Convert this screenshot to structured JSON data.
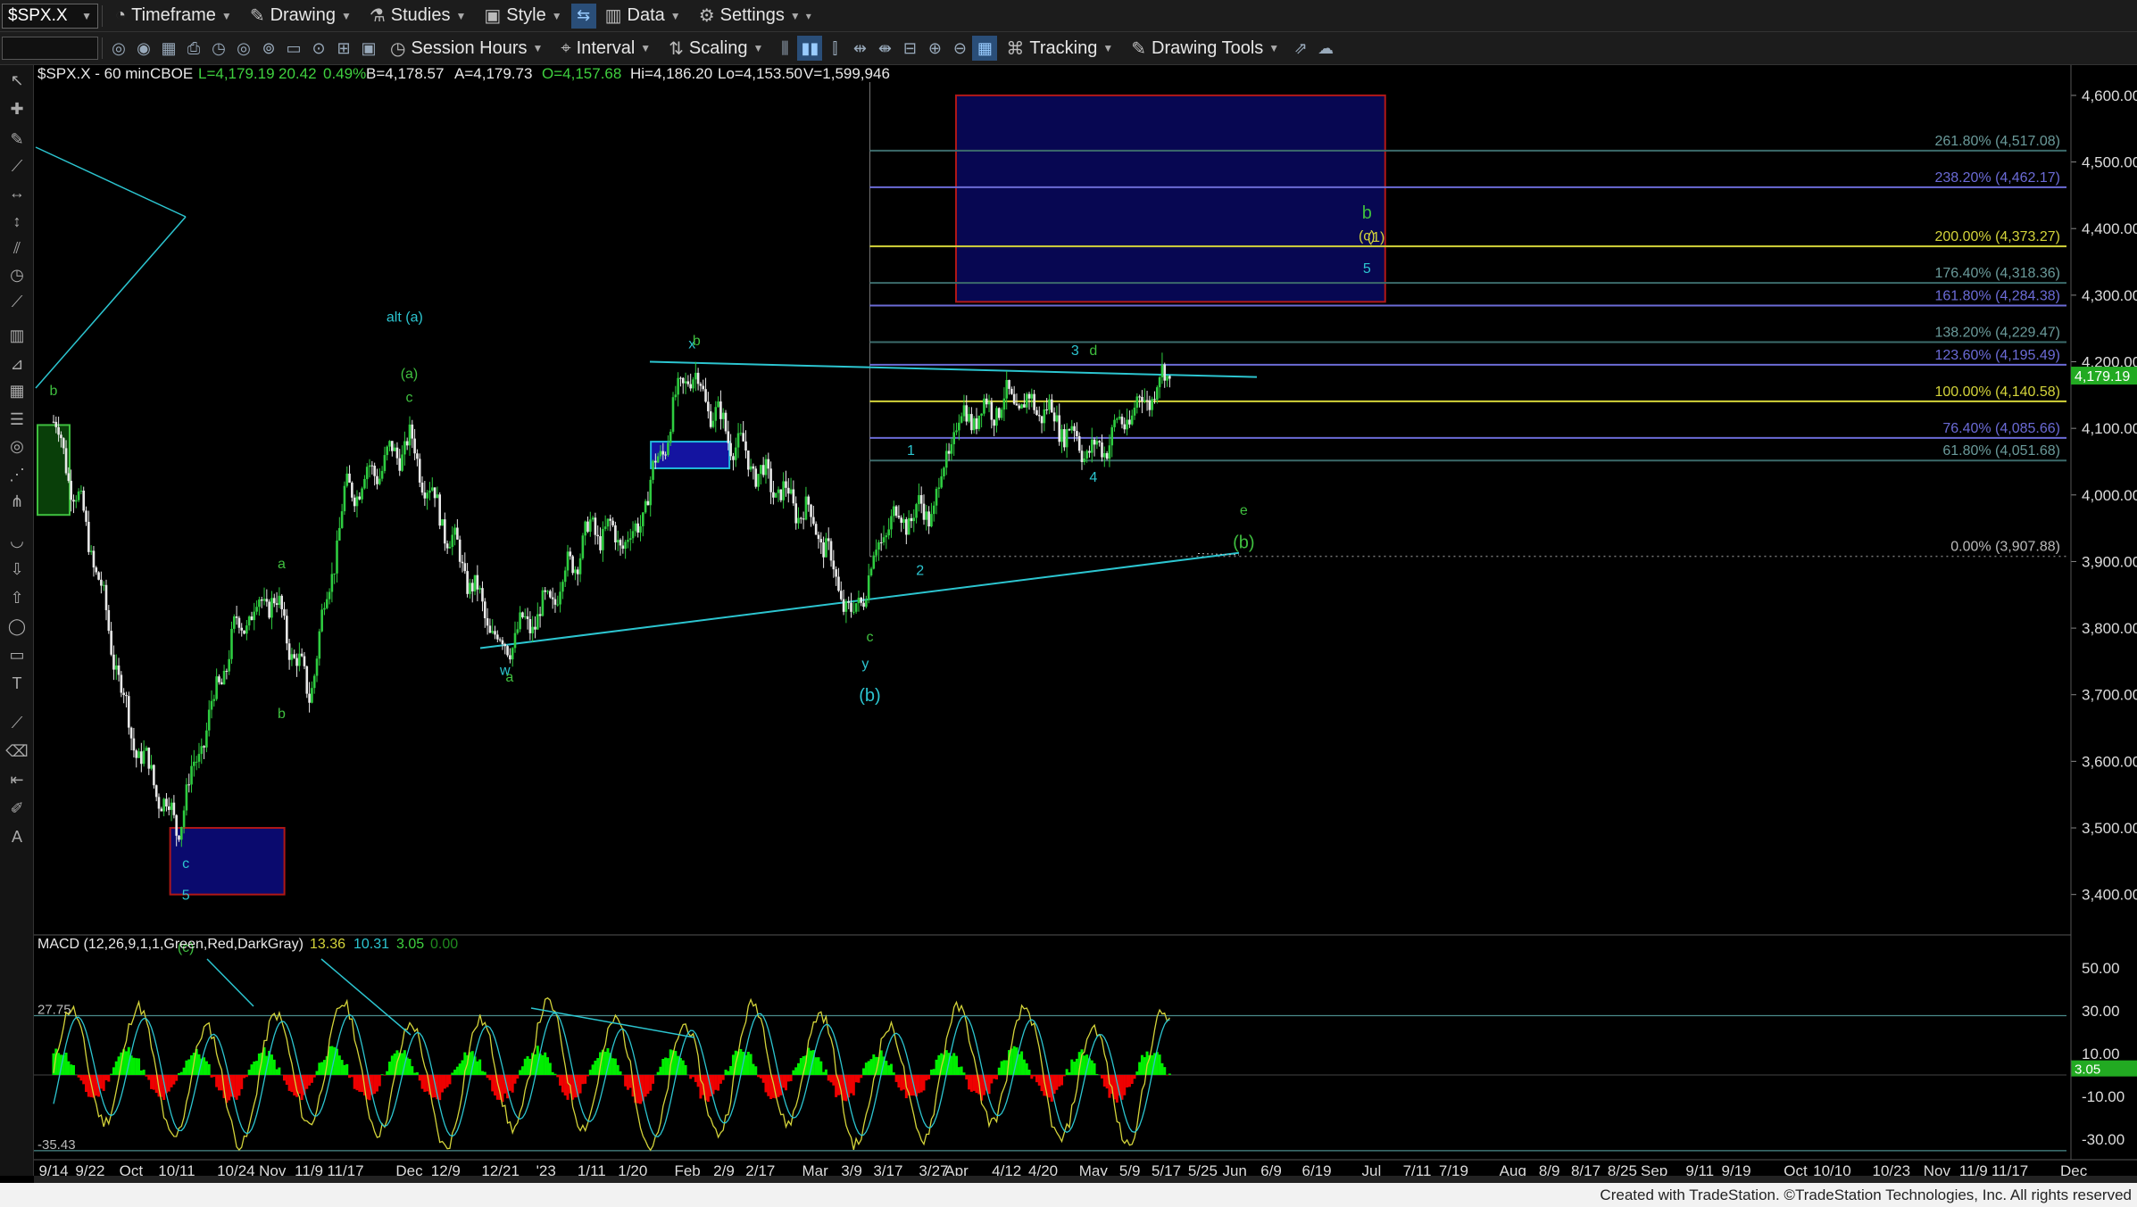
{
  "toolbar1": {
    "symbol": "$SPX.X",
    "items": [
      "Timeframe",
      "Drawing",
      "Studies",
      "Style",
      "Data",
      "Settings"
    ]
  },
  "toolbar2": {
    "items": [
      "Session Hours",
      "Interval",
      "Scaling",
      "Tracking",
      "Drawing Tools"
    ]
  },
  "header": {
    "title": "$SPX.X - 60 min",
    "exchange": "CBOE",
    "last": "L=4,179.19",
    "change": "20.42",
    "pct": "0.49%",
    "bid": "B=4,178.57",
    "ask": "A=4,179.73",
    "open": "O=4,157.68",
    "high": "Hi=4,186.20",
    "low": "Lo=4,153.50",
    "volume": "V=1,599,946"
  },
  "footer": "Created with TradeStation. ©TradeStation Technologies, Inc. All rights reserved",
  "colors": {
    "up": "#2ecc40",
    "down": "#e8e8e8",
    "fib": "#3c6b6b",
    "box_blue": "#0a0a6e",
    "box_red": "#b01818",
    "macd_pos": "#00ee00",
    "macd_neg": "#ee0000",
    "wave_green": "#3fbf3f",
    "wave_cyan": "#2cc5d0",
    "yellow": "#d4d43a"
  },
  "chart_data": {
    "type": "candlestick",
    "symbol": "$SPX.X",
    "interval": "60 min",
    "ylim": [
      3350,
      4620
    ],
    "y_ticks": [
      "4,600.00",
      "4,500.00",
      "4,400.00",
      "4,300.00",
      "4,200.00",
      "4,100.00",
      "4,000.00",
      "3,900.00",
      "3,800.00",
      "3,700.00",
      "3,600.00",
      "3,500.00",
      "3,400.00"
    ],
    "y_tick_values": [
      4600,
      4500,
      4400,
      4300,
      4200,
      4100,
      4000,
      3900,
      3800,
      3700,
      3600,
      3500,
      3400
    ],
    "last_price_label": "4,179.19",
    "x_labels": [
      "9/14",
      "9/22",
      "Oct",
      "10/11",
      "10/24",
      "Nov",
      "11/9",
      "11/17",
      "Dec",
      "12/9",
      "12/21",
      "'23",
      "1/11",
      "1/20",
      "Feb",
      "2/9",
      "2/17",
      "Mar",
      "3/9",
      "3/17",
      "3/27",
      "Apr",
      "4/12",
      "4/20",
      "May",
      "5/9",
      "5/17",
      "5/25",
      "Jun",
      "6/9",
      "6/19",
      "Jul",
      "7/11",
      "7/19",
      "Aug",
      "8/9",
      "8/17",
      "8/25",
      "Sep",
      "9/11",
      "9/19",
      "Oct",
      "10/10",
      "10/23",
      "Nov",
      "11/9",
      "11/17",
      "Dec"
    ],
    "price_path": [
      [
        "9/14",
        4110
      ],
      [
        "9/22",
        3930
      ],
      [
        "Oct",
        3640
      ],
      [
        "10/11",
        3500
      ],
      [
        "10/24",
        3800
      ],
      [
        "Nov",
        3850
      ],
      [
        "11/9",
        3700
      ],
      [
        "11/17",
        4000
      ],
      [
        "Dec",
        4080
      ],
      [
        "12/9",
        3950
      ],
      [
        "12/21",
        3770
      ],
      [
        "'23",
        3830
      ],
      [
        "1/11",
        3950
      ],
      [
        "1/20",
        3930
      ],
      [
        "Feb",
        4190
      ],
      [
        "2/9",
        4100
      ],
      [
        "2/17",
        4030
      ],
      [
        "Mar",
        3960
      ],
      [
        "3/9",
        3810
      ],
      [
        "3/17",
        3960
      ],
      [
        "3/27",
        3980
      ],
      [
        "Apr",
        4110
      ],
      [
        "4/12",
        4140
      ],
      [
        "4/20",
        4130
      ],
      [
        "May",
        4060
      ],
      [
        "5/9",
        4120
      ],
      [
        "5/17",
        4179
      ]
    ],
    "fib_levels": [
      {
        "label": "261.80% (4,517.08)",
        "value": 4517.08,
        "color": "#3c6b6b"
      },
      {
        "label": "238.20% (4,462.17)",
        "value": 4462.17,
        "color": "#6b6bd6"
      },
      {
        "label": "200.00% (4,373.27)",
        "value": 4373.27,
        "color": "#d4d43a"
      },
      {
        "label": "176.40% (4,318.36)",
        "value": 4318.36,
        "color": "#3c6b6b"
      },
      {
        "label": "161.80% (4,284.38)",
        "value": 4284.38,
        "color": "#6b6bd6"
      },
      {
        "label": "138.20% (4,229.47)",
        "value": 4229.47,
        "color": "#3c6b6b"
      },
      {
        "label": "123.60% (4,195.49)",
        "value": 4195.49,
        "color": "#6b6bd6"
      },
      {
        "label": "100.00% (4,140.58)",
        "value": 4140.58,
        "color": "#d4d43a"
      },
      {
        "label": "76.40% (4,085.66)",
        "value": 4085.66,
        "color": "#6b6bd6"
      },
      {
        "label": "61.80% (4,051.68)",
        "value": 4051.68,
        "color": "#3c6b6b"
      },
      {
        "label": "0.00% (3,907.88)",
        "value": 3907.88,
        "color": "#777777"
      }
    ],
    "wave_labels": [
      {
        "text": "b",
        "date": "9/14",
        "price": 4150,
        "color": "green"
      },
      {
        "text": "alt (a)",
        "date": "11/30",
        "price": 4260,
        "color": "cyan"
      },
      {
        "text": "(a)",
        "date": "12/1",
        "price": 4175,
        "color": "green"
      },
      {
        "text": "c",
        "date": "12/1",
        "price": 4140,
        "color": "green"
      },
      {
        "text": "a",
        "date": "11/3",
        "price": 3890,
        "color": "green"
      },
      {
        "text": "b",
        "date": "11/3",
        "price": 3665,
        "color": "green"
      },
      {
        "text": "c",
        "date": "10/13",
        "price": 3440,
        "color": "cyan"
      },
      {
        "text": "5",
        "date": "10/13",
        "price": 3392,
        "color": "cyan"
      },
      {
        "text": "(c)",
        "date": "10/13",
        "price": 3314,
        "color": "green"
      },
      {
        "text": "w",
        "date": "12/22",
        "price": 3730,
        "color": "cyan"
      },
      {
        "text": "a",
        "date": "12/23",
        "price": 3720,
        "color": "green"
      },
      {
        "text": "x",
        "date": "2/2",
        "price": 4220,
        "color": "cyan"
      },
      {
        "text": "b",
        "date": "2/3",
        "price": 4225,
        "color": "green"
      },
      {
        "text": "c",
        "date": "3/13",
        "price": 3780,
        "color": "green"
      },
      {
        "text": "y",
        "date": "3/12",
        "price": 3740,
        "color": "cyan"
      },
      {
        "text": "(b)",
        "date": "3/13",
        "price": 3690,
        "color": "cyan"
      },
      {
        "text": "1",
        "date": "3/22",
        "price": 4060,
        "color": "cyan"
      },
      {
        "text": "2",
        "date": "3/24",
        "price": 3880,
        "color": "cyan"
      },
      {
        "text": "3",
        "date": "4/27",
        "price": 4210,
        "color": "cyan"
      },
      {
        "text": "d",
        "date": "5/1",
        "price": 4210,
        "color": "green"
      },
      {
        "text": "4",
        "date": "5/1",
        "price": 4020,
        "color": "cyan"
      },
      {
        "text": "e",
        "date": "6/3",
        "price": 3970,
        "color": "green"
      },
      {
        "text": "(b)",
        "date": "6/3",
        "price": 3920,
        "color": "green"
      },
      {
        "text": "b",
        "date": "6/30",
        "price": 4415,
        "color": "green"
      },
      {
        "text": "(c)",
        "date": "6/30",
        "price": 4382,
        "color": "yellow"
      },
      {
        "text": "(1)",
        "date": "7/2",
        "price": 4380,
        "color": "yellow"
      },
      {
        "text": "5",
        "date": "6/30",
        "price": 4333,
        "color": "cyan"
      }
    ],
    "target_box": {
      "from": "3/27",
      "to": "7/4",
      "top": 4600,
      "bottom": 4290
    },
    "low_box": {
      "from": "10/8",
      "to": "10/24",
      "top": 3500,
      "bottom": 3400
    },
    "resistance_box": {
      "from": "1/23",
      "to": "1/30",
      "top": 4080,
      "bottom": 4040
    },
    "high_box": {
      "from": "9/14",
      "to": "9/22",
      "top": 4105,
      "bottom": 3970
    },
    "macd": {
      "label": "MACD (12,26,9,1,1,Green,Red,DarkGray)",
      "values": [
        "13.36",
        "10.31",
        "3.05",
        "0.00"
      ],
      "ylim": [
        -38,
        58
      ],
      "y_ticks": [
        "50.00",
        "30.00",
        "10.00",
        "-10.00",
        "-30.00"
      ],
      "y_tick_values": [
        50,
        30,
        10,
        -10,
        -30
      ],
      "ref_lines": [
        {
          "label": "27.75",
          "value": 27.75
        },
        {
          "label": "-35.43",
          "value": -35.43
        }
      ],
      "last_label": "3.05"
    }
  }
}
